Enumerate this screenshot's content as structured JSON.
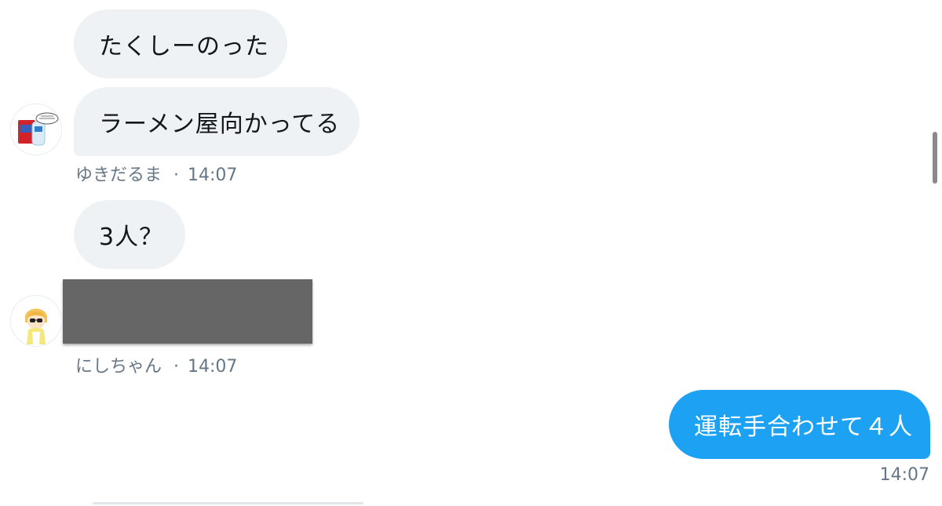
{
  "conversation": {
    "messages": [
      {
        "id": "m1",
        "direction": "incoming",
        "text": "たくしーのった"
      },
      {
        "id": "m2",
        "direction": "incoming",
        "text": "ラーメン屋向かってる"
      },
      {
        "id": "m3",
        "direction": "incoming",
        "text": "3人？"
      },
      {
        "id": "m4",
        "direction": "incoming",
        "text": "",
        "redacted": true
      },
      {
        "id": "m5",
        "direction": "outgoing",
        "text": "運転手合わせて４人"
      }
    ],
    "groups": [
      {
        "sender": "ゆきだるま",
        "separator": "·",
        "time": "14:07",
        "avatar_icon": "drink-can-avatar-icon"
      },
      {
        "sender": "にしちゃん",
        "separator": "·",
        "time": "14:07",
        "avatar_icon": "character-avatar-icon"
      }
    ],
    "outgoing_time": "14:07"
  },
  "colors": {
    "incoming_bubble": "#eff2f4",
    "outgoing_bubble": "#1da1f2",
    "meta_text": "#657786",
    "redaction": "#666666"
  }
}
